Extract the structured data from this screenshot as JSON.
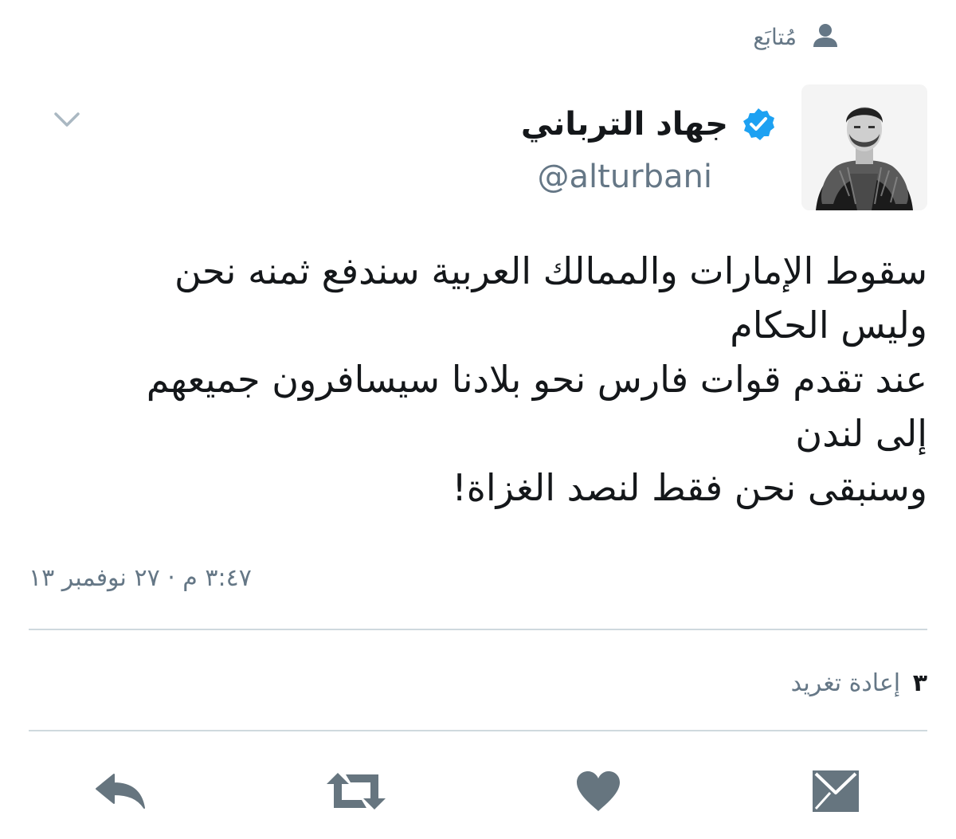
{
  "follow": {
    "label": "مُتابَع",
    "icon": "person-icon"
  },
  "author": {
    "display_name": "جهاد الترباني",
    "handle": "@alturbani",
    "verified": true
  },
  "tweet": {
    "lines": [
      "سقوط الإمارات والممالك العربية سندفع ثمنه نحن",
      "وليس الحكام",
      "عند تقدم قوات فارس نحو بلادنا سيسافرون جميعهم",
      "إلى لندن",
      "وسنبقى نحن فقط لنصد الغزاة!"
    ],
    "timestamp": "٣:٤٧ م · ٢٧ نوفمبر ١٣"
  },
  "stats": {
    "retweet_count": "٣",
    "retweet_label": "إعادة تغريد"
  },
  "actions": {
    "reply_icon": "reply-icon",
    "retweet_icon": "retweet-icon",
    "like_icon": "heart-icon",
    "dm_icon": "envelope-icon"
  },
  "colors": {
    "secondary_text": "#657786",
    "icon_gray": "#66757f",
    "verified_blue": "#1da1f2",
    "divider": "#cfd9de"
  }
}
